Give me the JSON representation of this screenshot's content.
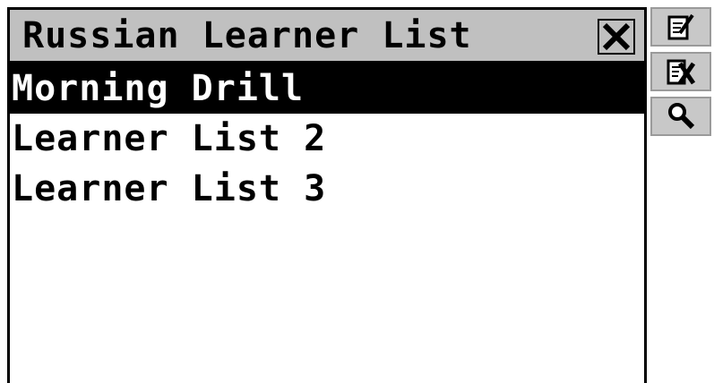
{
  "window": {
    "title": "Russian Learner List"
  },
  "list": {
    "items": [
      {
        "label": "Morning Drill",
        "selected": true
      },
      {
        "label": "Learner List 2",
        "selected": false
      },
      {
        "label": "Learner List 3",
        "selected": false
      }
    ]
  },
  "toolbar": {
    "icons": [
      "edit-note-icon",
      "delete-note-icon",
      "magnifier-icon"
    ]
  },
  "colors": {
    "selection_bg": "#000000",
    "titlebar_bg": "#c0c0c0",
    "button_bg": "#c8c8c8"
  }
}
